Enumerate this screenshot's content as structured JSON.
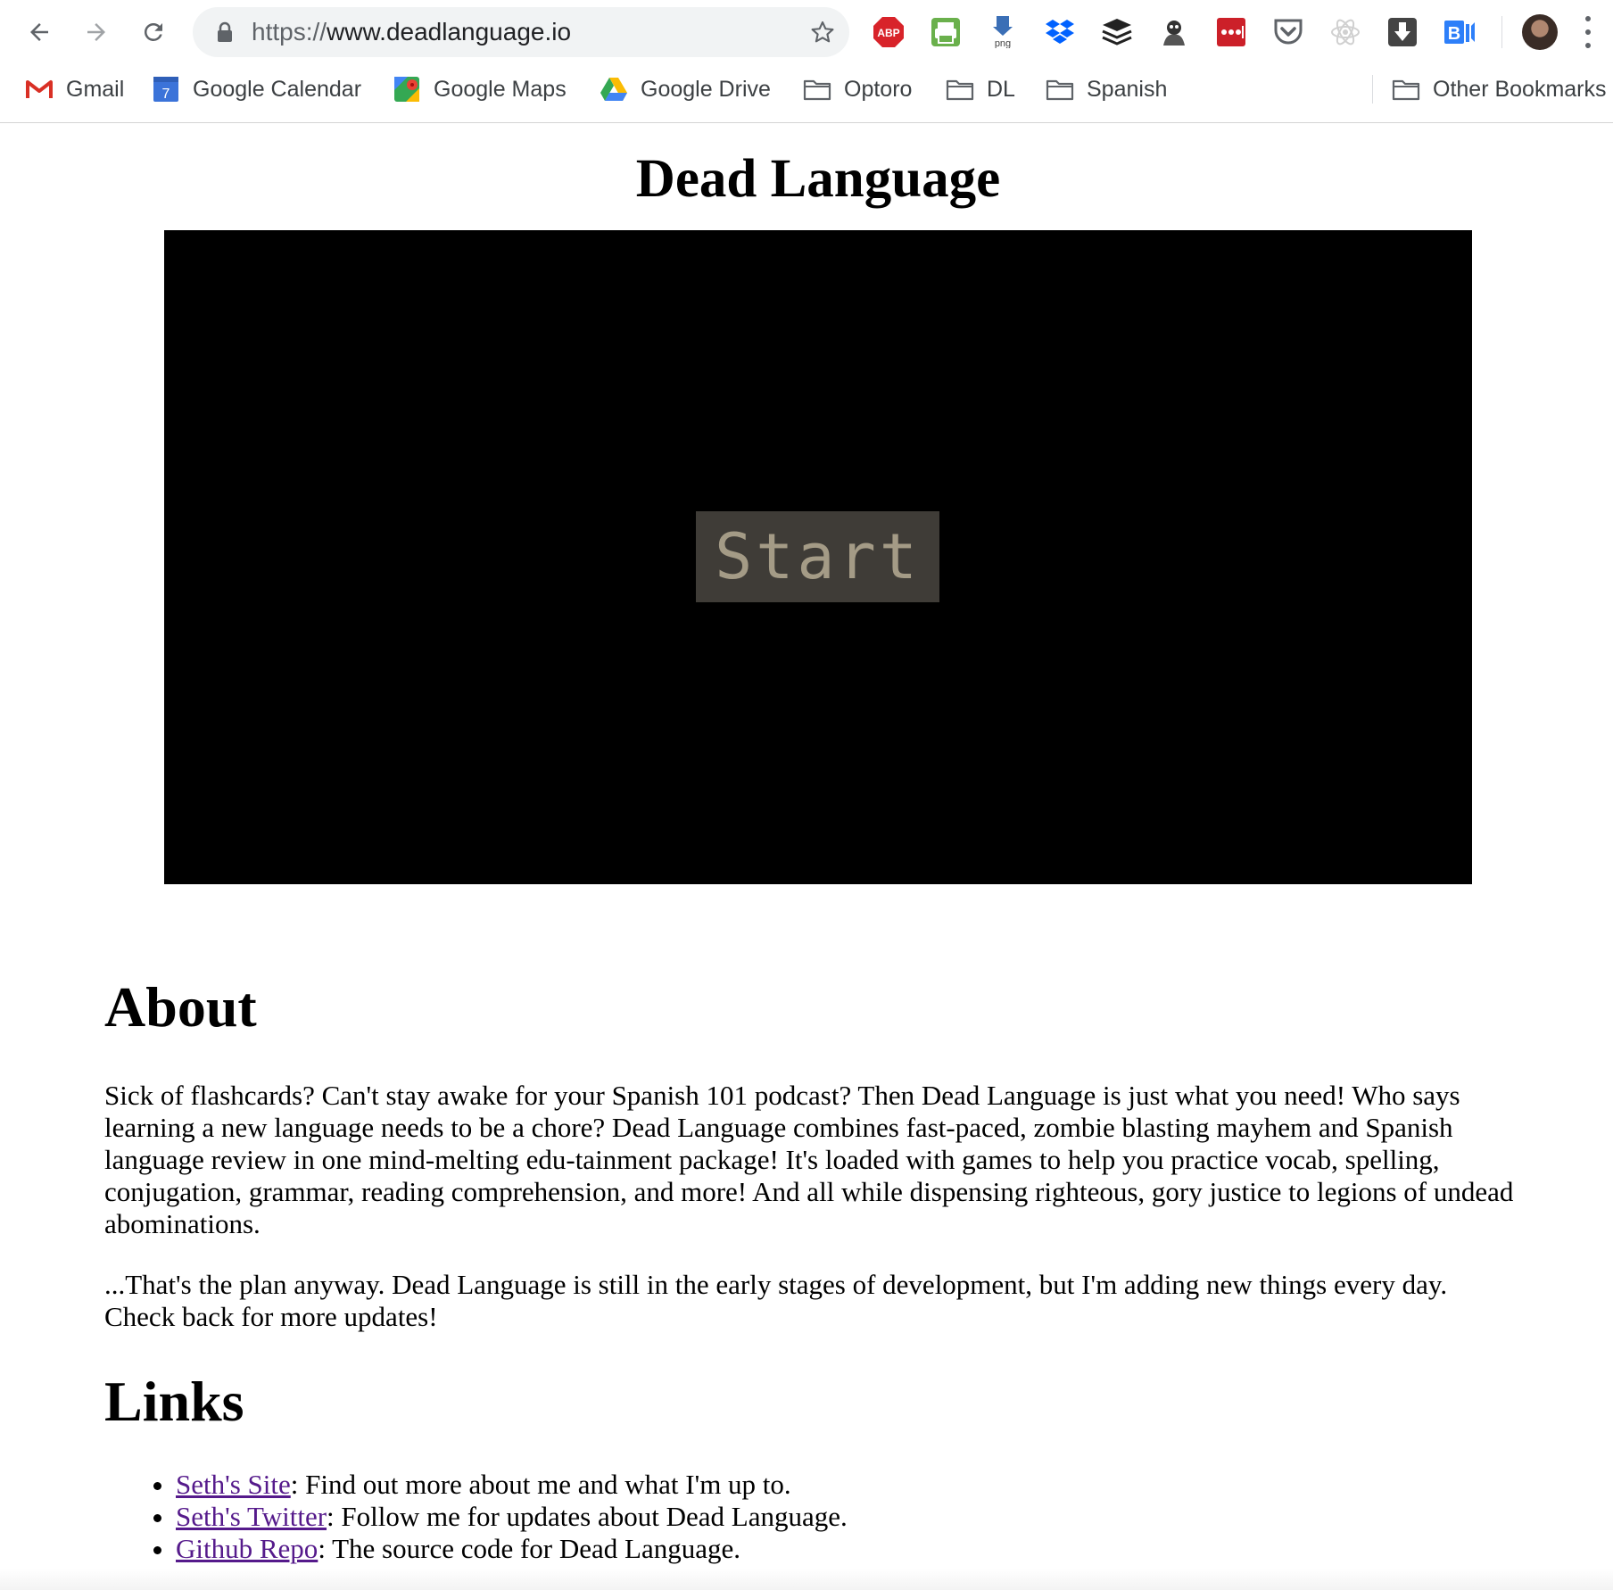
{
  "browser": {
    "url_scheme": "https://",
    "url_host": "www.deadlanguage.io",
    "extensions": [
      "adblock-plus-icon",
      "print-friendly-icon",
      "png-download-icon",
      "dropbox-icon",
      "buffer-icon",
      "zombie-extension-icon",
      "lastpass-icon",
      "pocket-icon",
      "react-devtools-icon",
      "download-icon",
      "bi-icon"
    ],
    "abp_label": "ABP",
    "png_label": "png",
    "bi_label": "B",
    "bookmarks": [
      {
        "label": "Gmail",
        "icon": "gmail-icon"
      },
      {
        "label": "Google Calendar",
        "icon": "calendar-icon",
        "badge": "7"
      },
      {
        "label": "Google Maps",
        "icon": "maps-icon"
      },
      {
        "label": "Google Drive",
        "icon": "drive-icon"
      },
      {
        "label": "Optoro",
        "icon": "folder-icon"
      },
      {
        "label": "DL",
        "icon": "folder-icon"
      },
      {
        "label": "Spanish",
        "icon": "folder-icon"
      }
    ],
    "other_bookmarks": "Other Bookmarks"
  },
  "page": {
    "title": "Dead Language",
    "game": {
      "start_label": "Start"
    },
    "about": {
      "heading": "About",
      "p1": "Sick of flashcards? Can't stay awake for your Spanish 101 podcast? Then Dead Language is just what you need! Who says learning a new language needs to be a chore? Dead Language combines fast-paced, zombie blasting mayhem and Spanish language review in one mind-melting edu-tainment package! It's loaded with games to help you practice vocab, spelling, conjugation, grammar, reading comprehension, and more! And all while dispensing righteous, gory justice to legions of undead abominations.",
      "p2": "...That's the plan anyway. Dead Language is still in the early stages of development, but I'm adding new things every day. Check back for more updates!"
    },
    "links": {
      "heading": "Links",
      "items": [
        {
          "link": "Seth's Site",
          "text": ": Find out more about me and what I'm up to."
        },
        {
          "link": "Seth's Twitter",
          "text": ": Follow me for updates about Dead Language."
        },
        {
          "link": "Github Repo",
          "text": ": The source code for Dead Language."
        }
      ]
    }
  },
  "colors": {
    "link": "#551a8b",
    "start_bg": "#3f3c37",
    "start_text": "#a49b86",
    "game_bg": "#000000"
  }
}
